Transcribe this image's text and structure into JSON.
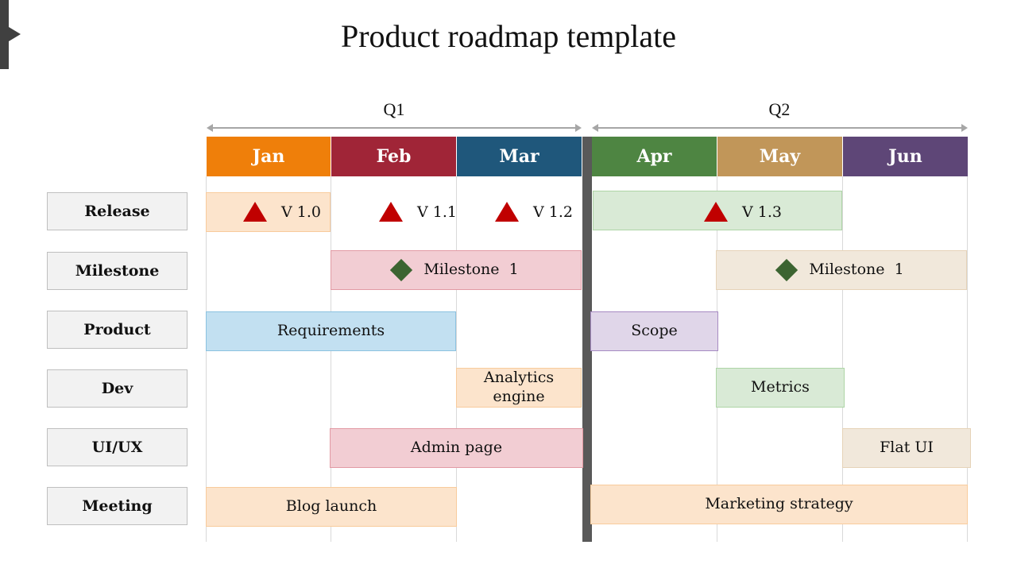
{
  "title": "Product roadmap template",
  "quarters": [
    {
      "label": "Q1"
    },
    {
      "label": "Q2"
    }
  ],
  "months": [
    {
      "label": "Jan",
      "color": "#ef7f0a"
    },
    {
      "label": "Feb",
      "color": "#a02537"
    },
    {
      "label": "Mar",
      "color": "#1f577b"
    },
    {
      "label": "Apr",
      "color": "#4e8542"
    },
    {
      "label": "May",
      "color": "#c19659"
    },
    {
      "label": "Jun",
      "color": "#5e4677"
    }
  ],
  "rows": [
    {
      "label": "Release"
    },
    {
      "label": "Milestone"
    },
    {
      "label": "Product"
    },
    {
      "label": "Dev"
    },
    {
      "label": "UI/UX"
    },
    {
      "label": "Meeting"
    }
  ],
  "release_markers": [
    {
      "label": "V 1.0",
      "icon": "triangle-icon",
      "color": "#c00000"
    },
    {
      "label": "V 1.1",
      "icon": "triangle-icon",
      "color": "#c00000"
    },
    {
      "label": "V 1.2",
      "icon": "triangle-icon",
      "color": "#c00000"
    },
    {
      "label": "V 1.3",
      "icon": "triangle-icon",
      "color": "#c00000"
    }
  ],
  "milestones": [
    {
      "label": "Milestone  1",
      "icon": "diamond-icon",
      "color": "#3c6431"
    },
    {
      "label": "Milestone  1",
      "icon": "diamond-icon",
      "color": "#3c6431"
    }
  ],
  "tasks": {
    "requirements": "Requirements",
    "scope": "Scope",
    "analytics_engine": "Analytics engine",
    "metrics": "Metrics",
    "admin_page": "Admin page",
    "flat_ui": "Flat UI",
    "blog_launch": "Blog launch",
    "marketing_strategy": "Marketing strategy"
  },
  "colors": {
    "peach": "#fce4cc",
    "peach_border": "#f8cb9c",
    "pink": "#f2cdd3",
    "pink_border": "#e29aa4",
    "blue": "#c2e0f1",
    "blue_border": "#8bc2e0",
    "lavender": "#e0d6e9",
    "lavender_border": "#a68ac2",
    "green": "#d9ead6",
    "green_border": "#aed5a6",
    "beige": "#f1e8db",
    "beige_border": "#e6d3b8"
  }
}
